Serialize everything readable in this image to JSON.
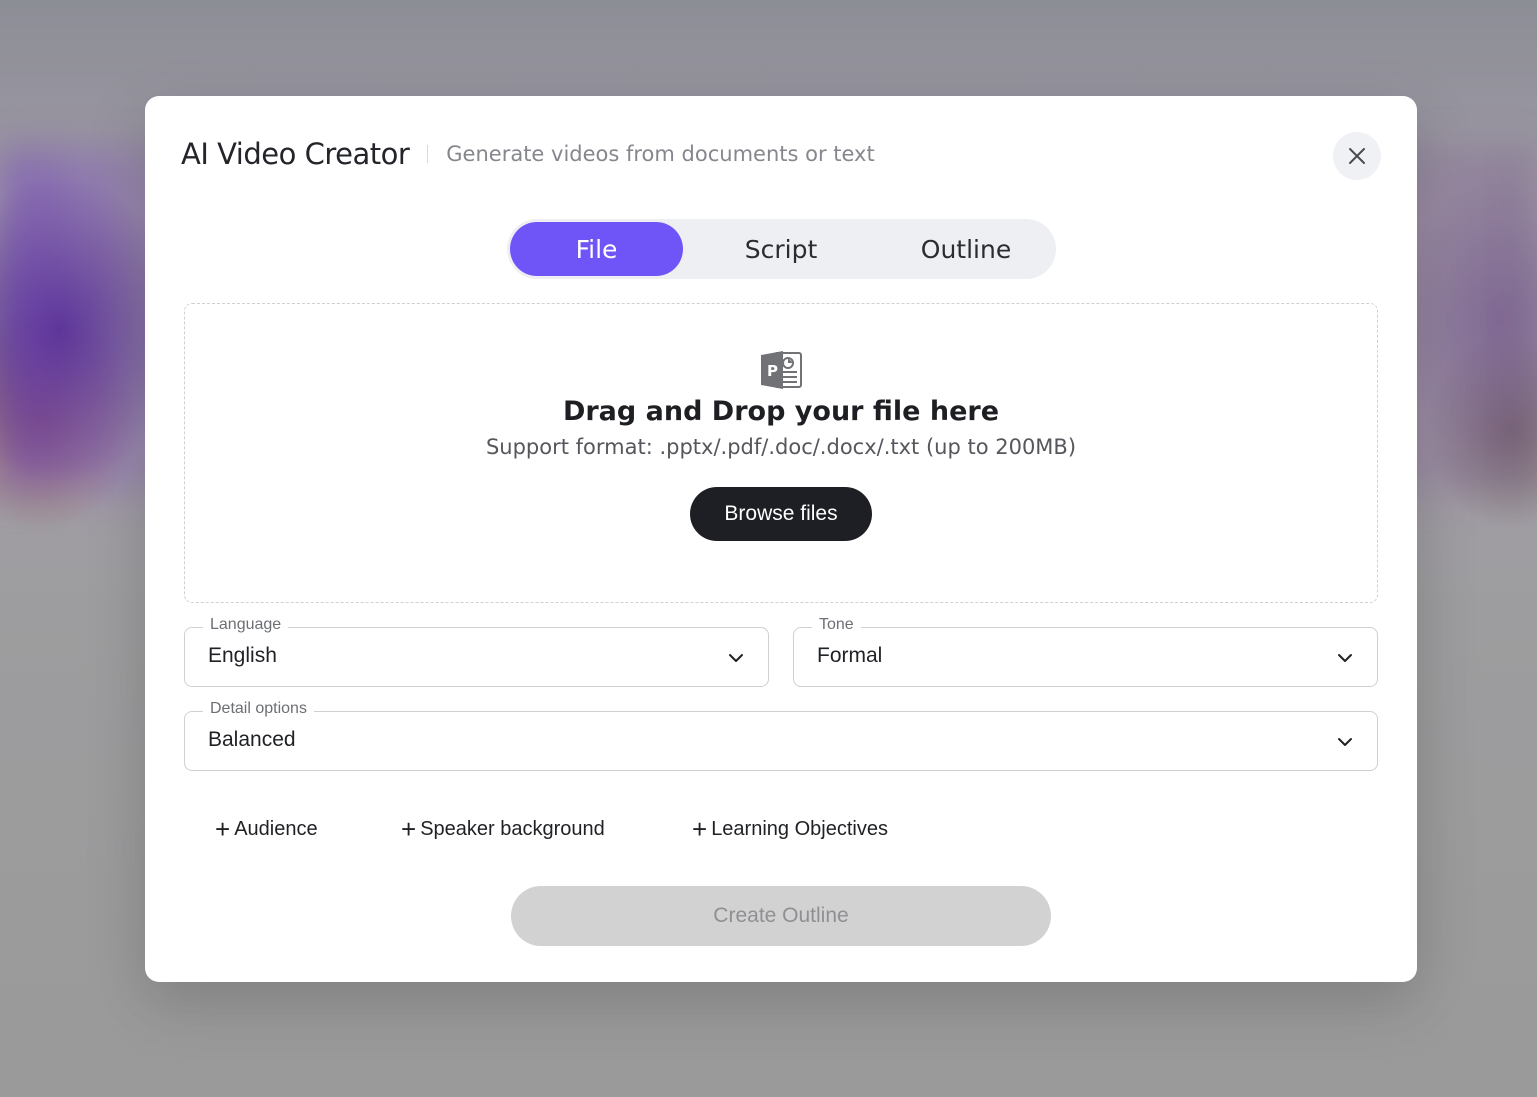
{
  "header": {
    "title": "AI Video Creator",
    "subtitle": "Generate videos from documents or text",
    "close_icon": "close-icon"
  },
  "tabs": [
    {
      "label": "File",
      "active": true
    },
    {
      "label": "Script",
      "active": false
    },
    {
      "label": "Outline",
      "active": false
    }
  ],
  "dropzone": {
    "icon": "powerpoint-file-icon",
    "title": "Drag and Drop your file here",
    "support": "Support format: .pptx/.pdf/.doc/.docx/.txt (up to 200MB)",
    "browse_label": "Browse files"
  },
  "fields": {
    "language": {
      "label": "Language",
      "value": "English"
    },
    "tone": {
      "label": "Tone",
      "value": "Formal"
    },
    "detail": {
      "label": "Detail options",
      "value": "Balanced"
    }
  },
  "adders": [
    {
      "label": "Audience"
    },
    {
      "label": "Speaker background"
    },
    {
      "label": "Learning Objectives"
    }
  ],
  "create_label": "Create Outline",
  "colors": {
    "accent": "#6f55f8",
    "dark_button": "#1e1f24",
    "disabled_button": "#d2d2d3"
  }
}
